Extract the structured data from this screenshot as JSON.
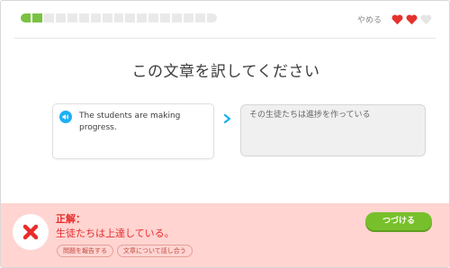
{
  "header": {
    "progress": {
      "segments_total": 17,
      "segments_filled": 2
    },
    "quit_label": "やめる",
    "hearts": {
      "filled": 2,
      "total": 3,
      "filled_color": "#e5322d",
      "empty_color": "#e5e5e5"
    }
  },
  "prompt": {
    "title": "この文章を訳してください"
  },
  "source": {
    "text": "The students are making progress.",
    "audio_icon": "speaker-icon"
  },
  "answer": {
    "value": "その生徒たちは進捗を作っている"
  },
  "feedback": {
    "status_icon": "x-mark-icon",
    "label": "正解：",
    "correct_answer": "生徒たちは上達している。",
    "report_label": "問題を報告する",
    "discuss_label": "文章について話し合う",
    "continue_label": "つづける",
    "background_color": "#ffd4d1",
    "accent_color": "#ea2b2b",
    "button_color": "#78c02b"
  }
}
